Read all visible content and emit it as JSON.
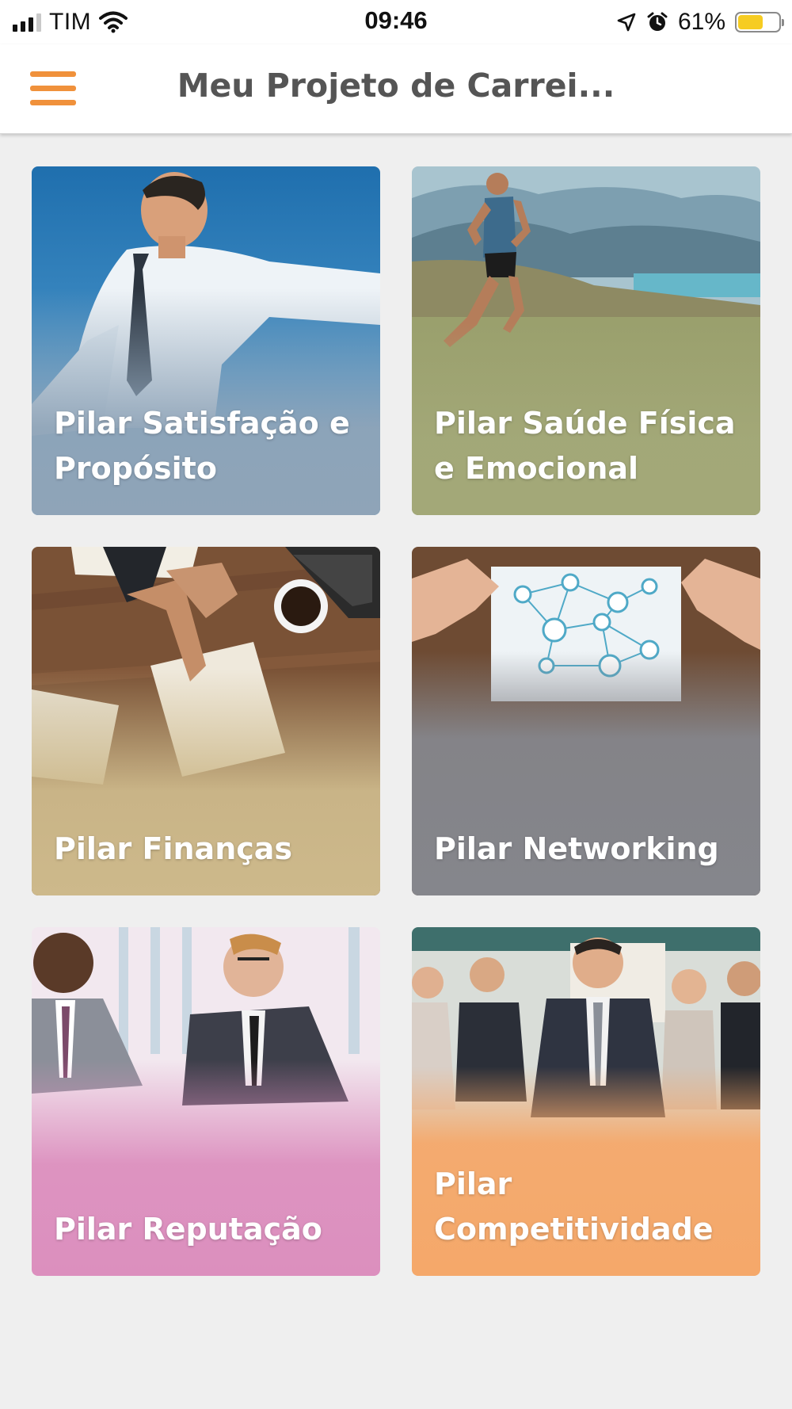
{
  "status_bar": {
    "carrier": "TIM",
    "time": "09:46",
    "battery": "61%",
    "battery_level": 0.61,
    "icons": [
      "signal-icon",
      "wifi-icon",
      "location-arrow-icon",
      "alarm-icon",
      "battery-icon"
    ]
  },
  "header": {
    "title": "Meu Projeto de Carrei...",
    "menu_icon": "hamburger-menu-icon",
    "accent_color": "#f0913b"
  },
  "cards": [
    {
      "label": "Pilar Satisfação e Propósito",
      "tint": "#8fa4b8",
      "image": "businessman-arms-open"
    },
    {
      "label": "Pilar Saúde Física e Emocional",
      "tint": "#a3a878",
      "image": "runner-landscape"
    },
    {
      "label": "Pilar Finanças",
      "tint": "#cdb98b",
      "image": "desk-documents-coffee"
    },
    {
      "label": "Pilar Networking",
      "tint": "#85868c",
      "image": "network-puzzle"
    },
    {
      "label": "Pilar Reputação",
      "tint": "#dc8fbe",
      "image": "business-meeting"
    },
    {
      "label": "Pilar Competitividade",
      "tint": "#f5a86a",
      "image": "business-team"
    }
  ]
}
